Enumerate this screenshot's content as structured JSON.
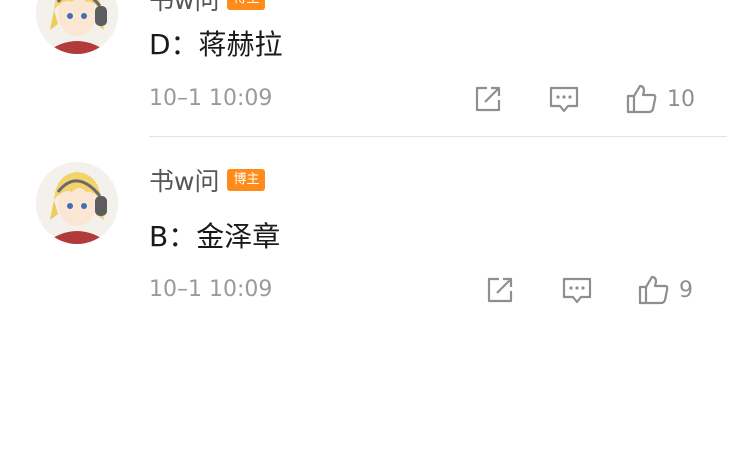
{
  "comments": [
    {
      "username": "书w问",
      "badge": "博主",
      "text": "D：蒋赫拉",
      "time": "10–1 10:09",
      "likes": "10"
    },
    {
      "username": "书w问",
      "badge": "博主",
      "text": "B：金泽章",
      "time": "10–1 10:09",
      "likes": "9"
    }
  ],
  "icons": {
    "share": "share-icon",
    "comment": "comment-icon",
    "like": "like-icon"
  },
  "colors": {
    "badge": "#ff8c1a",
    "meta_text": "#9a9a9a",
    "icon": "#8f8f8f",
    "divider": "#e2e2e2"
  }
}
